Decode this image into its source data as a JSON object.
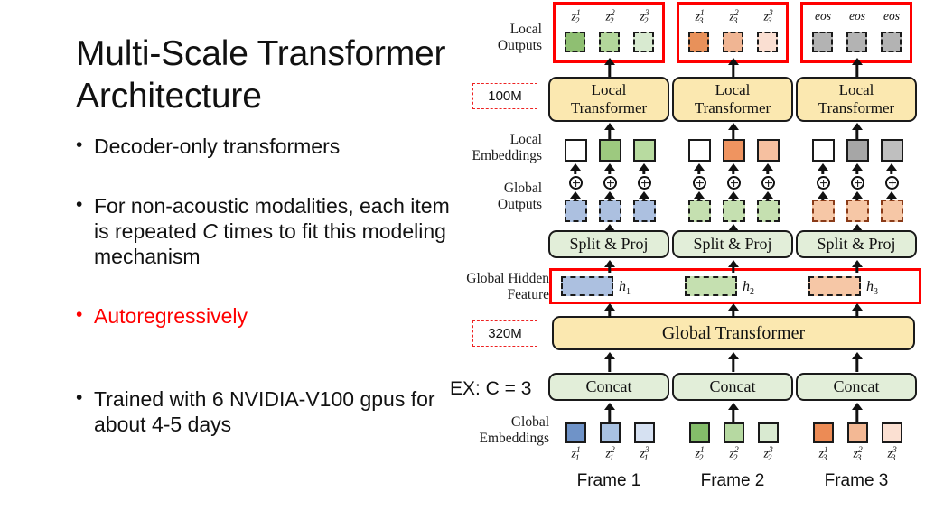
{
  "slide": {
    "title": "Multi-Scale Transformer Architecture",
    "bullets": [
      {
        "id": "b1",
        "text": "Decoder-only transformers",
        "color": "#111111"
      },
      {
        "id": "b2",
        "text_before": "For non-acoustic modalities, each item is repeated ",
        "italic": "C",
        "text_after": " times to fit this modeling mechanism",
        "color": "#111111"
      },
      {
        "id": "b3",
        "text": "Autoregressively",
        "color": "#ff0000"
      },
      {
        "id": "b4",
        "text": "Trained with 6 NVIDIA-V100 gpus for about 4-5 days",
        "color": "#111111"
      }
    ]
  },
  "diagram": {
    "row_labels": {
      "local_outputs": "Local\nOutputs",
      "local_outputs_l1": "Local",
      "local_outputs_l2": "Outputs",
      "local_embeddings_l1": "Local",
      "local_embeddings_l2": "Embeddings",
      "global_outputs_l1": "Global",
      "global_outputs_l2": "Outputs",
      "global_hidden_l1": "Global Hidden",
      "global_hidden_l2": "Feature",
      "global_embeddings_l1": "Global",
      "global_embeddings_l2": "Embeddings"
    },
    "badges": {
      "local_params": "100M",
      "global_params": "320M"
    },
    "ex_label": "EX: C = 3",
    "blocks": {
      "local_transformer_l1": "Local",
      "local_transformer_l2": "Transformer",
      "split_proj": "Split & Proj",
      "global_transformer": "Global Transformer",
      "concat": "Concat"
    },
    "hidden_features": [
      "h",
      "h",
      "h"
    ],
    "hidden_subs": [
      "1",
      "2",
      "3"
    ],
    "frames": [
      "Frame 1",
      "Frame 2",
      "Frame 3"
    ],
    "columns": [
      {
        "index": 1,
        "local_output_tokens": [
          {
            "base": "z",
            "sub": "2",
            "sup": "1"
          },
          {
            "base": "z",
            "sub": "2",
            "sup": "2"
          },
          {
            "base": "z",
            "sub": "2",
            "sup": "3"
          }
        ],
        "local_output_colors": [
          "#8fbf72",
          "#b3d69b",
          "#d8ead0"
        ],
        "local_embedding_colors": [
          "#ffffff",
          "#9dc97f",
          "#b8dba0"
        ],
        "global_output_colors": [
          "#acc0e0",
          "#acc0e0",
          "#acc0e0"
        ],
        "global_output_border": "#111111",
        "hidden_color": "#acc0e0",
        "global_embedding_colors": [
          "#6f93c8",
          "#a9c2e2",
          "#d6e1f2"
        ],
        "global_embedding_tokens": [
          {
            "base": "z",
            "sub": "1",
            "sup": "1"
          },
          {
            "base": "z",
            "sub": "1",
            "sup": "2"
          },
          {
            "base": "z",
            "sub": "1",
            "sup": "3"
          }
        ]
      },
      {
        "index": 2,
        "local_output_tokens": [
          {
            "base": "z",
            "sub": "3",
            "sup": "1"
          },
          {
            "base": "z",
            "sub": "3",
            "sup": "2"
          },
          {
            "base": "z",
            "sub": "3",
            "sup": "3"
          }
        ],
        "local_output_colors": [
          "#e8915a",
          "#f0b593",
          "#fadfd2"
        ],
        "local_embedding_colors": [
          "#ffffff",
          "#ef9460",
          "#f6c0a0"
        ],
        "global_output_colors": [
          "#c5e0b0",
          "#c5e0b0",
          "#c5e0b0"
        ],
        "global_output_border": "#111111",
        "hidden_color": "#c5e0b0",
        "global_embedding_colors": [
          "#84bd6a",
          "#b6d9a1",
          "#d9ead1"
        ],
        "global_embedding_tokens": [
          {
            "base": "z",
            "sub": "2",
            "sup": "1"
          },
          {
            "base": "z",
            "sub": "2",
            "sup": "2"
          },
          {
            "base": "z",
            "sub": "2",
            "sup": "3"
          }
        ]
      },
      {
        "index": 3,
        "local_output_tokens": [
          {
            "base": "eos"
          },
          {
            "base": "eos"
          },
          {
            "base": "eos"
          }
        ],
        "local_output_colors": [
          "#b3b3b3",
          "#b3b3b3",
          "#b3b3b3"
        ],
        "local_embedding_colors": [
          "#ffffff",
          "#a6a6a6",
          "#bfbfbf"
        ],
        "global_output_colors": [
          "#f6c7a6",
          "#f6c7a6",
          "#f6c7a6"
        ],
        "global_output_border": "#8a3b18",
        "hidden_color": "#f6c7a6",
        "global_embedding_colors": [
          "#ec8b55",
          "#f3b894",
          "#fbe0d2"
        ],
        "global_embedding_tokens": [
          {
            "base": "z",
            "sub": "3",
            "sup": "1"
          },
          {
            "base": "z",
            "sub": "3",
            "sup": "2"
          },
          {
            "base": "z",
            "sub": "3",
            "sup": "3"
          }
        ]
      }
    ],
    "colors": {
      "highlight_red": "#ff0000",
      "yellow_block": "#fbe8b0",
      "green_block": "#e2eed9"
    }
  }
}
